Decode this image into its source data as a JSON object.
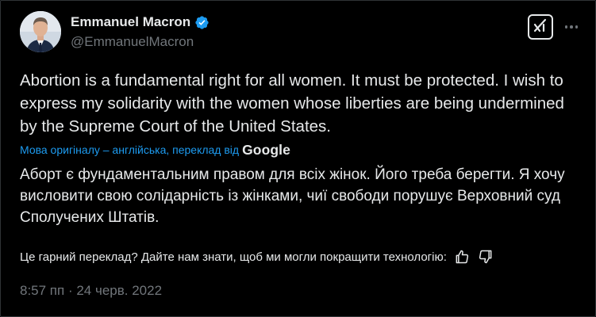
{
  "author": {
    "name": "Emmanuel Macron",
    "handle": "@EmmanuelMacron",
    "verified": true
  },
  "tweet": {
    "text": "Abortion is a fundamental right for all women. It must be protected. I wish to express my solidarity with the women whose liberties are being undermined by the Supreme Court of the United States.",
    "translation_label": "Мова оригіналу – англійська, переклад від",
    "translation_provider": "Google",
    "translated_text": "Аборт є фундаментальним правом для всіх жінок. Його треба берегти. Я хочу висловити свою солідарність із жінками, чиї свободи порушує Верховний суд Сполучених Штатів.",
    "feedback_prompt": "Це гарний переклад? Дайте нам знати, щоб ми могли покращити технологію:",
    "timestamp": "8:57 пп · 24 черв. 2022"
  },
  "icons": {
    "verified": "verified-badge-icon",
    "grok": "grok-icon",
    "more": "more-icon",
    "thumbs_up": "thumbs-up-icon",
    "thumbs_down": "thumbs-down-icon"
  },
  "colors": {
    "background": "#000000",
    "text": "#e7e9ea",
    "muted": "#71767b",
    "link": "#1d9bf0",
    "verified": "#1d9bf0"
  }
}
